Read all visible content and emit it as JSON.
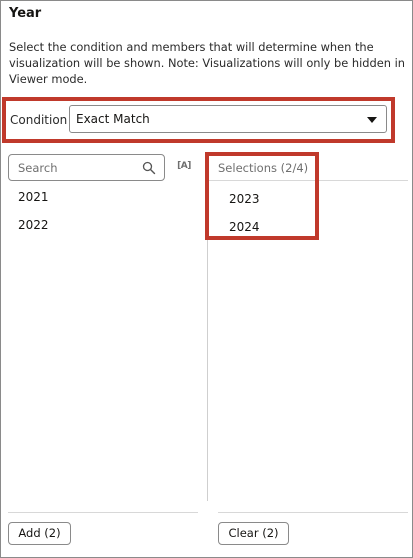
{
  "panel": {
    "title": "Year",
    "description": "Select the condition and members that will determine when the visualization will be shown. Note: Visualizations will only be hidden in Viewer mode."
  },
  "condition": {
    "label": "Condition",
    "value": "Exact Match",
    "icon": "chevron-down-icon"
  },
  "available": {
    "search_placeholder": "Search",
    "search_icon": "search-icon",
    "sort_icon_text": "[A]",
    "items": [
      "2021",
      "2022"
    ],
    "add_label": "Add (2)"
  },
  "selections": {
    "header": "Selections (2/4)",
    "items": [
      "2023",
      "2024"
    ],
    "clear_label": "Clear (2)"
  },
  "colors": {
    "highlight": "#c0392b",
    "border": "#8a8a8a",
    "muted_text": "#6f6f6f"
  }
}
